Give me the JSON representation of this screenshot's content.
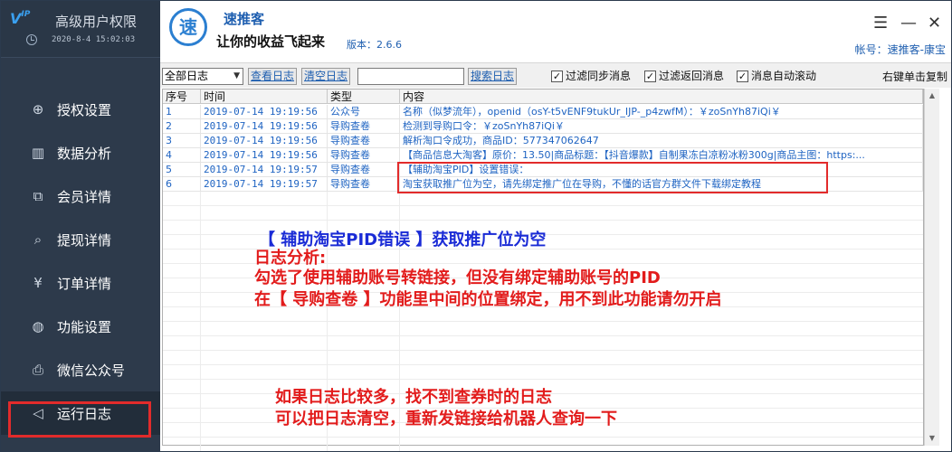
{
  "sidebar": {
    "logo_text": "V",
    "logo_sub": "IP",
    "title": "高级用户权限",
    "datetime": "2020-8-4 15:02:03",
    "items": [
      {
        "label": "授权设置",
        "icon": "globe-icon"
      },
      {
        "label": "数据分析",
        "icon": "chart-icon"
      },
      {
        "label": "会员详情",
        "icon": "external-link-icon"
      },
      {
        "label": "提现详情",
        "icon": "search-report-icon"
      },
      {
        "label": "订单详情",
        "icon": "yen-document-icon"
      },
      {
        "label": "功能设置",
        "icon": "chat-icon"
      },
      {
        "label": "微信公众号",
        "icon": "printer-icon"
      },
      {
        "label": "运行日志",
        "icon": "speaker-icon"
      }
    ]
  },
  "header": {
    "logo_char": "速",
    "app_name": "速推客",
    "slogan": "让你的收益飞起来",
    "version": "版本：2.6.6",
    "account": "帐号：速推客-康宝"
  },
  "toolbar": {
    "filter_selected": "全部日志",
    "view_log": "查看日志",
    "clear_log": "清空日志",
    "search_value": "",
    "search_log": "搜索日志",
    "filter_sync": "过滤同步消息",
    "filter_return": "过滤返回消息",
    "auto_scroll": "消息自动滚动",
    "right_click_copy": "右键单击复制"
  },
  "log_table": {
    "headers": [
      "序号",
      "时间",
      "类型",
      "内容"
    ],
    "rows": [
      {
        "no": "1",
        "time": "2019-07-14 19:19:56",
        "type": "公众号",
        "content": "名称（似梦流年），openid（osY-t5vENF9tukUr_IJP-_p4zwfM）：￥zoSnYh87iQi￥"
      },
      {
        "no": "2",
        "time": "2019-07-14 19:19:56",
        "type": "导购查卷",
        "content": "检测到导购口令：￥zoSnYh87iQi￥"
      },
      {
        "no": "3",
        "time": "2019-07-14 19:19:56",
        "type": "导购查卷",
        "content": "解析淘口令成功，商品ID：577347062647"
      },
      {
        "no": "4",
        "time": "2019-07-14 19:19:56",
        "type": "导购查卷",
        "content": "【商品信息大淘客】原价：13.50|商品标题：【抖音爆款】自制果冻白凉粉冰粉300g|商品主图：https:..."
      },
      {
        "no": "5",
        "time": "2019-07-14 19:19:57",
        "type": "导购查卷",
        "content": "【辅助淘宝PID】设置错误："
      },
      {
        "no": "6",
        "time": "2019-07-14 19:19:57",
        "type": "导购查卷",
        "content": "淘宝获取推广位为空，请先绑定推广位在导购，不懂的话官方群文件下载绑定教程"
      }
    ]
  },
  "annotations": {
    "blue_title": "【 辅助淘宝PID错误 】获取推广位为空",
    "analysis_label": "日志分析:",
    "analysis_line1": "勾选了使用辅助账号转链接，但没有绑定辅助账号的PID",
    "analysis_line2": "在【 导购查卷 】功能里中间的位置绑定，用不到此功能请勿开启",
    "tip_line1": "如果日志比较多，找不到查券时的日志",
    "tip_line2": "可以把日志清空，重新发链接给机器人查询一下"
  },
  "colors": {
    "sidebar_bg": "#2d3a4b",
    "accent_blue": "#1f5fb0",
    "log_text": "#1e63c2",
    "highlight_red": "#e22b2b"
  }
}
